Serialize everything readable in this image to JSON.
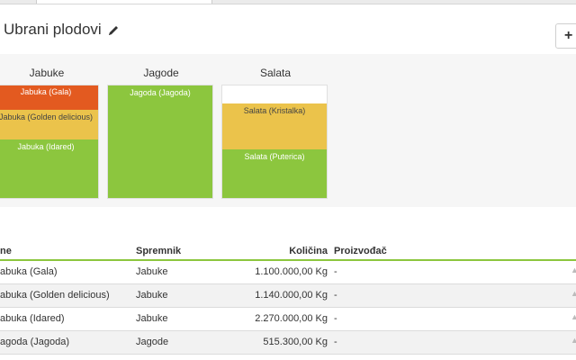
{
  "header": {
    "title": "Ubrani plodovi",
    "add_label": "+"
  },
  "containers": [
    {
      "name": "Jabuke",
      "segments": [
        {
          "label": "Jabuka (Gala)",
          "color": "#e35a20",
          "fill_fraction": 0.22
        },
        {
          "label": "Jabuka (Golden delicious)",
          "color": "#ebc34b",
          "fill_fraction": 0.26
        },
        {
          "label": "Jabuka (Idared)",
          "color": "#8cc63e",
          "fill_fraction": 0.52
        }
      ]
    },
    {
      "name": "Jagode",
      "segments": [
        {
          "label": "Jagoda (Jagoda)",
          "color": "#8cc63e",
          "fill_fraction": 1.0
        }
      ]
    },
    {
      "name": "Salata",
      "segments": [
        {
          "label": "Salata (Kristalka)",
          "color": "#ebc34b",
          "fill_fraction": 0.41
        },
        {
          "label": "Salata (Puterica)",
          "color": "#8cc63e",
          "fill_fraction": 0.43
        }
      ]
    }
  ],
  "table": {
    "columns": {
      "name": "ne",
      "container": "Spremnik",
      "quantity": "Količina",
      "producer": "Proizvođač"
    },
    "rows": [
      {
        "name": "abuka (Gala)",
        "container": "Jabuke",
        "quantity": "1.100.000,00 Kg",
        "producer": "-"
      },
      {
        "name": "abuka (Golden delicious)",
        "container": "Jabuke",
        "quantity": "1.140.000,00 Kg",
        "producer": "-"
      },
      {
        "name": "abuka (Idared)",
        "container": "Jabuke",
        "quantity": "2.270.000,00 Kg",
        "producer": "-"
      },
      {
        "name": "agoda (Jagoda)",
        "container": "Jagode",
        "quantity": "515.300,00 Kg",
        "producer": "-"
      }
    ]
  }
}
